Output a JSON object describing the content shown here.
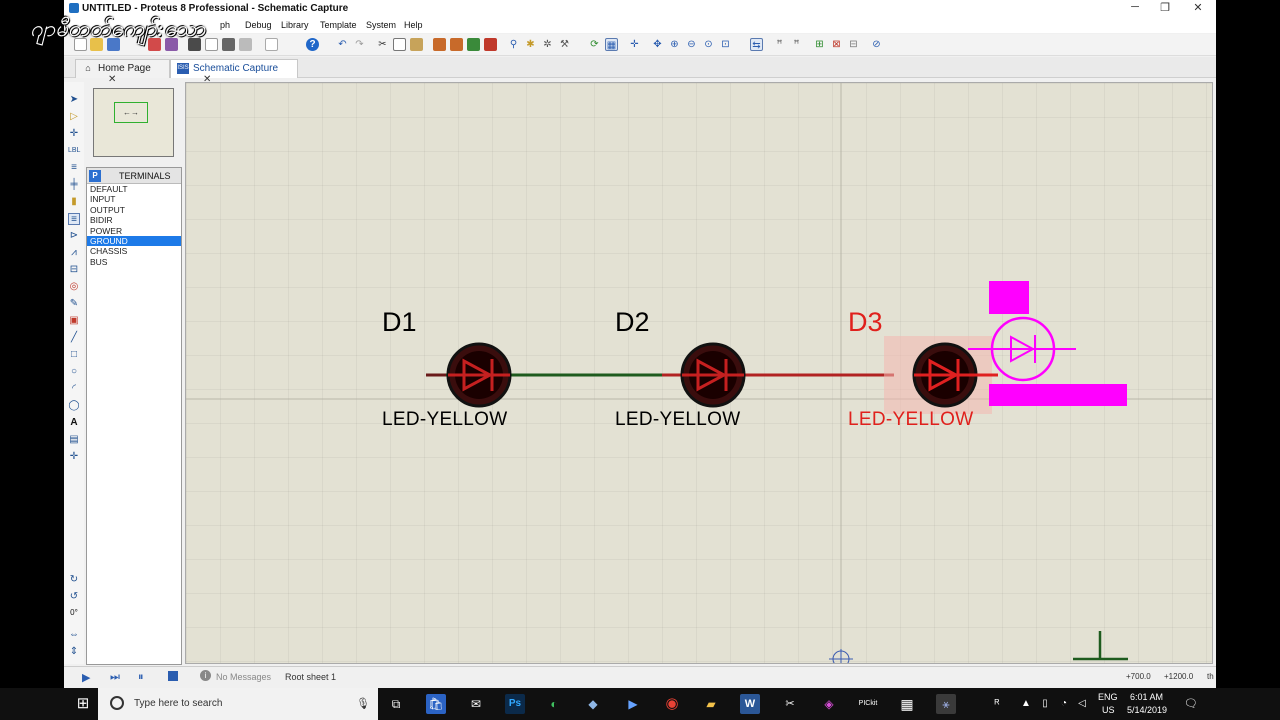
{
  "window": {
    "title": "UNTITLED - Proteus 8 Professional - Schematic Capture",
    "minimize": "─",
    "restore": "❐",
    "close": "✕"
  },
  "watermark": "ဂျာမီတတ်ကျော်:သော",
  "menu": [
    "Debug",
    "Library",
    "Template",
    "System",
    "Help"
  ],
  "menu_partial": "ph",
  "tabs": [
    {
      "label": "Home Page",
      "close": "✕",
      "icon": "home-icon"
    },
    {
      "label": "Schematic Capture",
      "close": "✕",
      "icon": "isis-icon",
      "icon_text": "ISIS"
    }
  ],
  "overview": {
    "marker": "←→"
  },
  "library": {
    "mode_button": "P",
    "title": "TERMINALS",
    "items": [
      "DEFAULT",
      "INPUT",
      "OUTPUT",
      "BIDIR",
      "POWER",
      "GROUND",
      "CHASSIS",
      "BUS"
    ],
    "selected": "GROUND"
  },
  "rotation": "0°",
  "schematic": {
    "components": [
      {
        "ref": "D1",
        "value": "LED-YELLOW",
        "state": "normal"
      },
      {
        "ref": "D2",
        "value": "LED-YELLOW",
        "state": "normal"
      },
      {
        "ref": "D3",
        "value": "LED-YELLOW",
        "state": "selected"
      }
    ]
  },
  "status": {
    "messages": "No Messages",
    "sheet": "Root sheet 1",
    "coords_x": "+700.0",
    "coords_y": "+1200.0",
    "unit": "th"
  },
  "taskbar": {
    "search_placeholder": "Type here to search",
    "lang_line1": "ENG",
    "lang_line2": "US",
    "time": "6:01 AM",
    "date": "5/14/2019"
  },
  "colors": {
    "canvas": "#e3e1d3",
    "selected_ref": "#e0201c",
    "ghost": "#ff00ff",
    "wire_green": "#1e5b1e",
    "wire_red": "#b22222"
  }
}
